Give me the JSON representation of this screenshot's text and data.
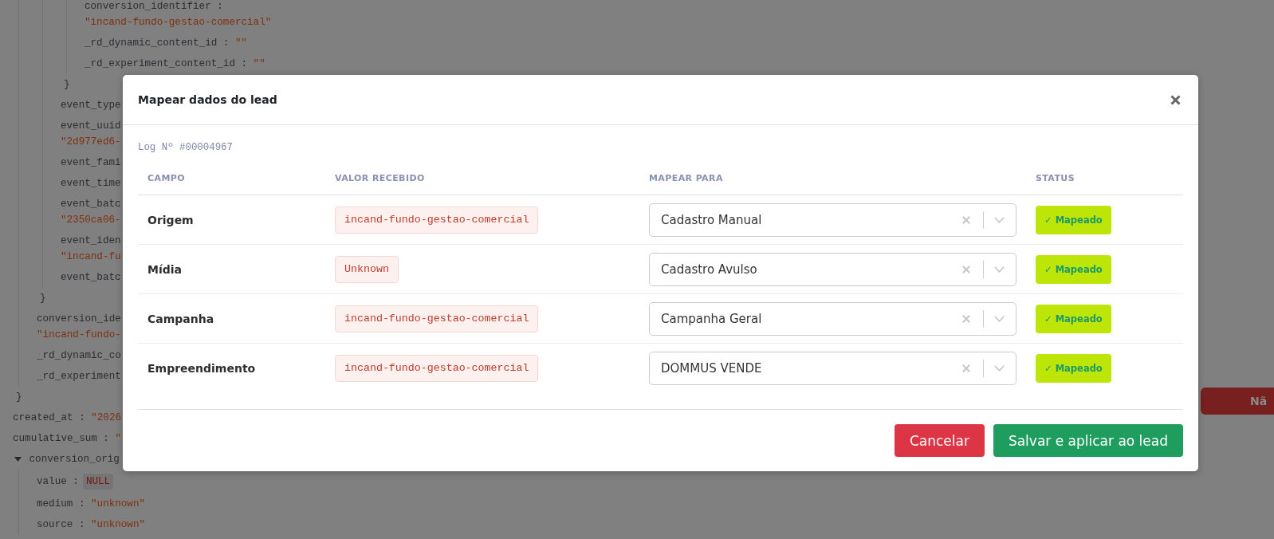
{
  "json_tree": {
    "nodes": [
      {
        "kind": "object",
        "close": "}",
        "children": [
          {
            "kind": "object",
            "close": "}",
            "children": [
              {
                "kind": "object",
                "close": "}",
                "children": [
                  {
                    "kind": "wrapped",
                    "key": "conversion_identifier :",
                    "value": "\"incand-fundo-gestao-comercial\""
                  },
                  {
                    "kind": "pair",
                    "key": "_rd_dynamic_content_id :",
                    "value": "\"\""
                  },
                  {
                    "kind": "pair",
                    "key": "_rd_experiment_content_id :",
                    "value": "\"\""
                  }
                ]
              },
              {
                "kind": "pair",
                "key": "event_type"
              },
              {
                "kind": "wrapped",
                "key": "event_uuid",
                "value": "\"2d977ed6-"
              },
              {
                "kind": "pair",
                "key": "event_fami"
              },
              {
                "kind": "pair",
                "key": "event_time"
              },
              {
                "kind": "wrapped",
                "key": "event_batc",
                "value": "\"2350ca06-"
              },
              {
                "kind": "wrapped",
                "key": "event_iden",
                "value": "\"incand-fu"
              },
              {
                "kind": "pair",
                "key": "event_batc"
              }
            ]
          },
          {
            "kind": "wrapped",
            "key": "conversion_ide",
            "value": "\"incand-fundo-"
          },
          {
            "kind": "pair",
            "key": "_rd_dynamic_co"
          },
          {
            "kind": "pair",
            "key": "_rd_experiment"
          }
        ]
      },
      {
        "kind": "pair",
        "key": "created_at :",
        "value": "\"2026"
      },
      {
        "kind": "pair",
        "key": "cumulative_sum :",
        "value": "\""
      },
      {
        "kind": "object",
        "key": "conversion_orig",
        "expanded": true,
        "children": [
          {
            "kind": "null",
            "key": "value :",
            "value": "NULL"
          },
          {
            "kind": "pair",
            "key": "medium :",
            "value": "\"unknown\""
          },
          {
            "kind": "pair",
            "key": "source :",
            "value": "\"unknown\""
          }
        ]
      }
    ]
  },
  "side_button": {
    "label": "Nã"
  },
  "modal": {
    "title": "Mapear dados do lead",
    "log_number": "Log Nº #00004967",
    "table": {
      "columns": [
        "CAMPO",
        "VALOR RECEBIDO",
        "MAPEAR PARA",
        "STATUS"
      ],
      "rows": [
        {
          "field": "Origem",
          "received_value": "incand-fundo-gestao-comercial",
          "mapped_to": "Cadastro Manual",
          "status": {
            "label": "✓ Mapeado",
            "mapped": true
          }
        },
        {
          "field": "Mídia",
          "received_value": "Unknown",
          "mapped_to": "Cadastro Avulso",
          "status": {
            "label": "✓ Mapeado",
            "mapped": true
          }
        },
        {
          "field": "Campanha",
          "received_value": "incand-fundo-gestao-comercial",
          "mapped_to": "Campanha Geral",
          "status": {
            "label": "✓ Mapeado",
            "mapped": true
          }
        },
        {
          "field": "Empreendimento",
          "received_value": "incand-fundo-gestao-comercial",
          "mapped_to": "DOMMUS VENDE",
          "status": {
            "label": "✓ Mapeado",
            "mapped": true
          }
        }
      ]
    },
    "buttons": [
      {
        "label": "Cancelar",
        "kind": "danger"
      },
      {
        "label": "Salvar e aplicar ao lead",
        "kind": "primary"
      }
    ]
  }
}
